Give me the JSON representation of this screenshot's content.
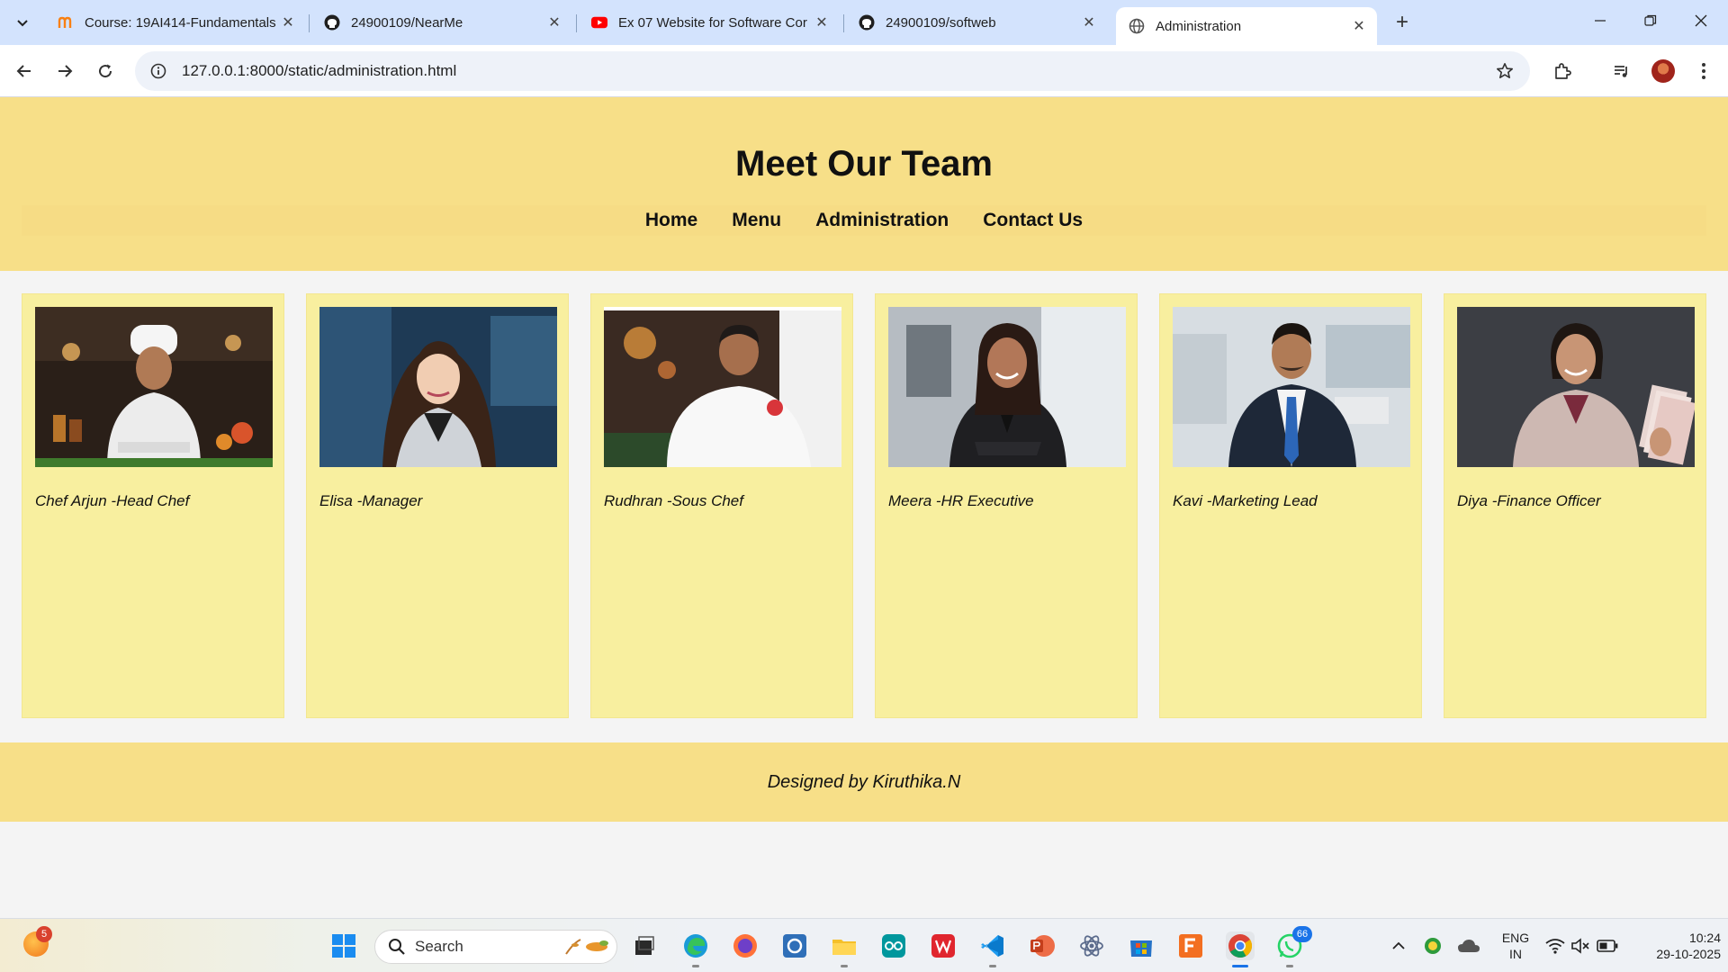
{
  "browser": {
    "tabs": [
      {
        "title": "Course: 19AI414-Fundamentals",
        "icon": "moodle-icon",
        "active": false
      },
      {
        "title": "24900109/NearMe",
        "icon": "github-icon",
        "active": false
      },
      {
        "title": "Ex 07 Website for Software Cor",
        "icon": "youtube-icon",
        "active": false
      },
      {
        "title": "24900109/softweb",
        "icon": "github-icon",
        "active": false
      },
      {
        "title": "Administration",
        "icon": "globe-icon",
        "active": true
      }
    ],
    "url": "127.0.0.1:8000/static/administration.html"
  },
  "page": {
    "title": "Meet Our Team",
    "nav": {
      "home": "Home",
      "menu": "Menu",
      "administration": "Administration",
      "contact": "Contact Us"
    },
    "team": [
      {
        "caption": "Chef Arjun -Head Chef",
        "photo": "head-chef-photo"
      },
      {
        "caption": "Elisa -Manager",
        "photo": "manager-photo"
      },
      {
        "caption": "Rudhran -Sous Chef",
        "photo": "sous-chef-photo"
      },
      {
        "caption": "Meera -HR Executive",
        "photo": "hr-executive-photo"
      },
      {
        "caption": "Kavi -Marketing Lead",
        "photo": "marketing-lead-photo"
      },
      {
        "caption": "Diya -Finance Officer",
        "photo": "finance-officer-photo"
      }
    ],
    "footer": "Designed by Kiruthika.N"
  },
  "taskbar": {
    "search_placeholder": "Search",
    "weather_badge": "5",
    "whatsapp_badge": "66",
    "language": "ENG",
    "region": "IN",
    "time": "10:24",
    "date": "29-10-2025"
  },
  "colors": {
    "header_bg": "#f7df88",
    "card_bg": "#f8ef9f",
    "tabstrip_bg": "#d3e3fd"
  }
}
